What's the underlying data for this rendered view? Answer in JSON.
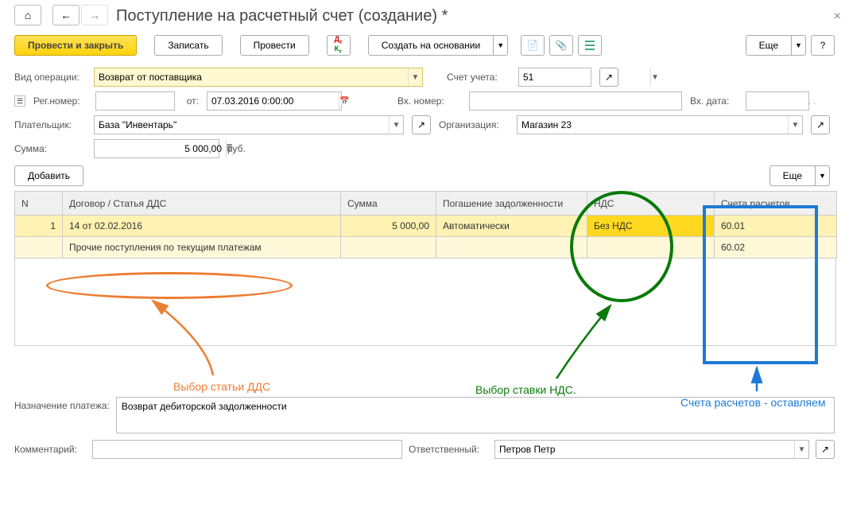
{
  "header": {
    "title": "Поступление на расчетный счет (создание) *"
  },
  "toolbar": {
    "post_close": "Провести и закрыть",
    "save": "Записать",
    "post": "Провести",
    "create_based": "Создать на основании",
    "more": "Еще"
  },
  "fields": {
    "operation_type_label": "Вид операции:",
    "operation_type": "Возврат от поставщика",
    "account_label": "Счет учета:",
    "account": "51",
    "regno_label": "Рег.номер:",
    "regno": "",
    "from_label": "от:",
    "date": "07.03.2016 0:00:00",
    "in_no_label": "Вх. номер:",
    "in_no": "",
    "in_date_label": "Вх. дата:",
    "in_date": ". .",
    "payer_label": "Плательщик:",
    "payer": "База \"Инвентарь\"",
    "org_label": "Организация:",
    "org": "Магазин 23",
    "sum_label": "Сумма:",
    "sum": "5 000,00",
    "currency": "руб."
  },
  "tab_toolbar": {
    "add": "Добавить",
    "more": "Еще"
  },
  "table": {
    "cols": {
      "n": "N",
      "contract": "Договор / Статья ДДС",
      "sum": "Сумма",
      "debt": "Погашение задолженности",
      "vat": "НДС",
      "acc": "Счета расчетов"
    },
    "row1": {
      "n": "1",
      "contract": "14 от 02.02.2016",
      "sum": "5 000,00",
      "debt": "Автоматически",
      "vat": "Без НДС",
      "acc": "60.01"
    },
    "row2": {
      "contract": "Прочие поступления по текущим платежам",
      "acc": "60.02"
    }
  },
  "annotations": {
    "dds": "Выбор статьи ДДС",
    "vat": "Выбор ставки НДС.",
    "acc": "Счета расчетов - оставляем"
  },
  "bottom": {
    "memo_label": "Назначение платежа:",
    "memo": "Возврат дебиторской задолженности",
    "comment_label": "Комментарий:",
    "comment": "",
    "responsible_label": "Ответственный:",
    "responsible": "Петров Петр"
  }
}
